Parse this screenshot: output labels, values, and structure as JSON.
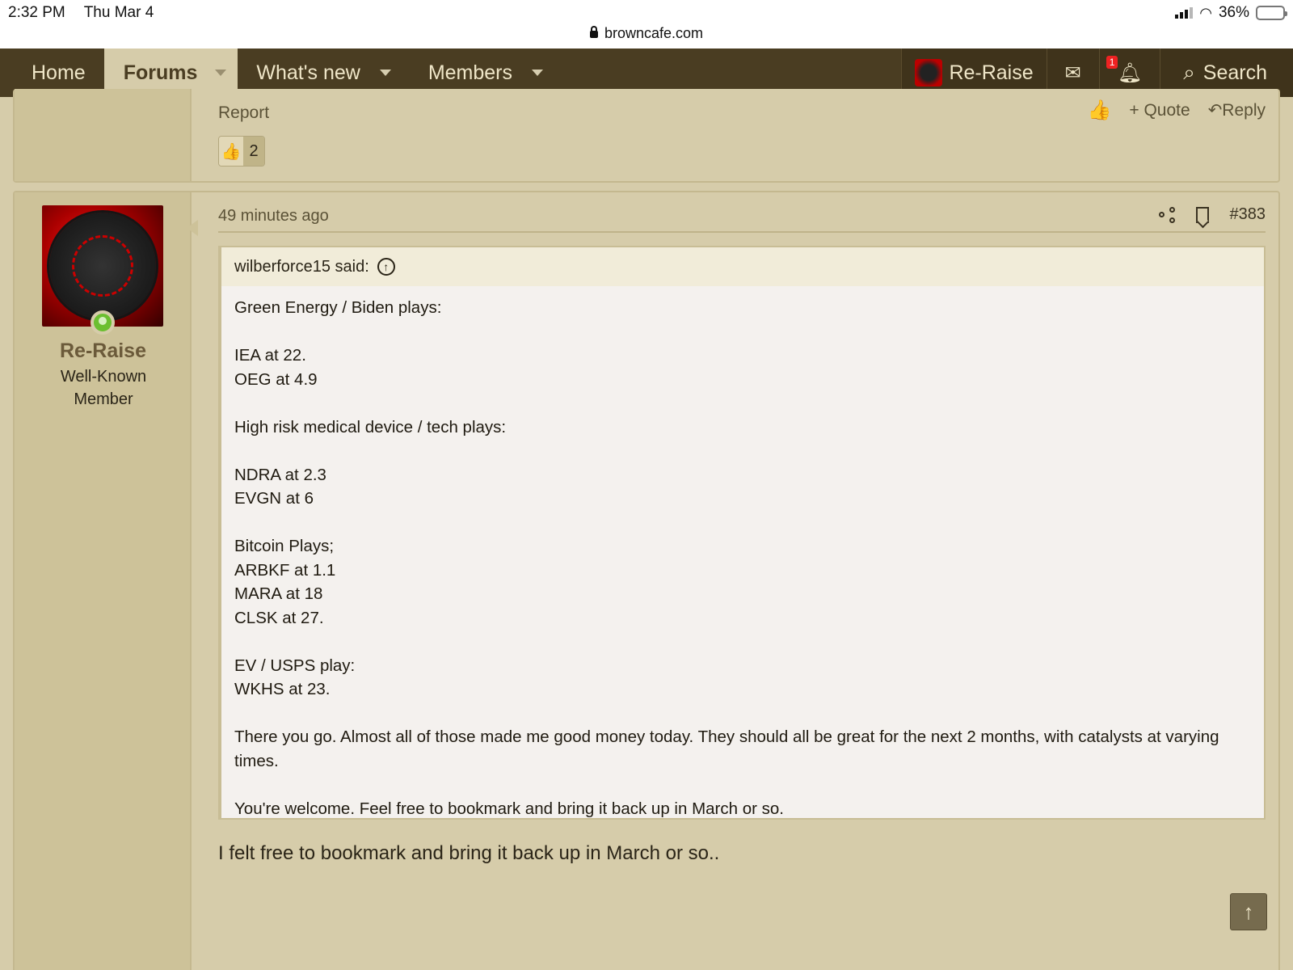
{
  "status_bar": {
    "time": "2:32 PM",
    "date": "Thu Mar 4",
    "battery": "36%",
    "battery_level": 0.36,
    "url": "browncafe.com"
  },
  "nav": {
    "items": [
      {
        "label": "Home"
      },
      {
        "label": "Forums"
      },
      {
        "label": "What's new"
      },
      {
        "label": "Members"
      }
    ],
    "user": "Re-Raise",
    "alert_count": "1",
    "search": "Search"
  },
  "prev_post": {
    "report": "Report",
    "quote": "Quote",
    "reply": "Reply",
    "reaction_count": "2"
  },
  "post": {
    "username": "Re-Raise",
    "user_title": "Well-Known Member",
    "time": "49 minutes ago",
    "number": "#383",
    "quote_author": "wilberforce15 said:",
    "quote_lines": [
      "Green Energy / Biden plays:",
      "",
      "IEA at 22.",
      "OEG at 4.9",
      "",
      "High risk medical device / tech plays:",
      "",
      "NDRA at 2.3",
      "EVGN at 6",
      "",
      "Bitcoin Plays;",
      "ARBKF at 1.1",
      "MARA at 18",
      "CLSK at 27.",
      "",
      "EV / USPS play:",
      "WKHS at 23.",
      "",
      "There you go. Almost all of those made me good money today. They should all be great for the next 2 months, with catalysts at varying times.",
      "",
      "You're welcome. Feel free to bookmark and bring it back up in March or so."
    ],
    "reply_text": "I felt free to bookmark and bring it back up in March or so.."
  },
  "colors": {
    "nav_bg": "#4a3d22",
    "page_bg": "#d6ccaa",
    "quote_bg": "#f4f1ee"
  },
  "icons": {
    "back_to_top": "arrow-up-icon"
  }
}
